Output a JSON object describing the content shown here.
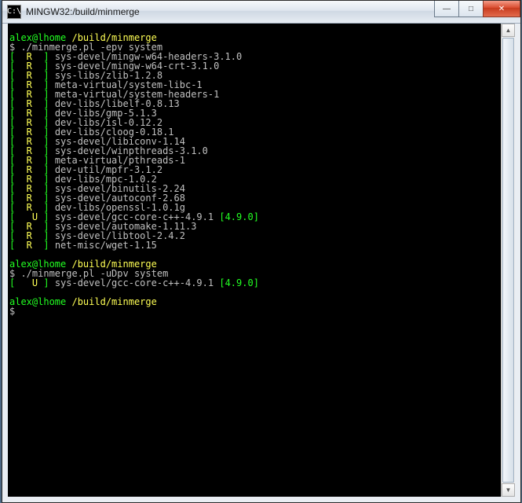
{
  "window": {
    "title": "MINGW32:/build/minmerge"
  },
  "controls": {
    "minimize_glyph": "—",
    "maximize_glyph": "□",
    "close_glyph": "✕"
  },
  "prompt": {
    "user_host": "alex@lhome",
    "path": "/build/minmerge",
    "sign": "$"
  },
  "blocks": [
    {
      "command": "./minmerge.pl -epv system",
      "rows": [
        {
          "flags": "  R  ",
          "pkg": "sys-devel/mingw-w64-headers-3.1.0"
        },
        {
          "flags": "  R  ",
          "pkg": "sys-devel/mingw-w64-crt-3.1.0"
        },
        {
          "flags": "  R  ",
          "pkg": "sys-libs/zlib-1.2.8"
        },
        {
          "flags": "  R  ",
          "pkg": "meta-virtual/system-libc-1"
        },
        {
          "flags": "  R  ",
          "pkg": "meta-virtual/system-headers-1"
        },
        {
          "flags": "  R  ",
          "pkg": "dev-libs/libelf-0.8.13"
        },
        {
          "flags": "  R  ",
          "pkg": "dev-libs/gmp-5.1.3"
        },
        {
          "flags": "  R  ",
          "pkg": "dev-libs/isl-0.12.2"
        },
        {
          "flags": "  R  ",
          "pkg": "dev-libs/cloog-0.18.1"
        },
        {
          "flags": "  R  ",
          "pkg": "sys-devel/libiconv-1.14"
        },
        {
          "flags": "  R  ",
          "pkg": "sys-devel/winpthreads-3.1.0"
        },
        {
          "flags": "  R  ",
          "pkg": "meta-virtual/pthreads-1"
        },
        {
          "flags": "  R  ",
          "pkg": "dev-util/mpfr-3.1.2"
        },
        {
          "flags": "  R  ",
          "pkg": "dev-libs/mpc-1.0.2"
        },
        {
          "flags": "  R  ",
          "pkg": "sys-devel/binutils-2.24"
        },
        {
          "flags": "  R  ",
          "pkg": "sys-devel/autoconf-2.68"
        },
        {
          "flags": "  R  ",
          "pkg": "dev-libs/openssl-1.0.1g"
        },
        {
          "flags": "   U ",
          "pkg": "sys-devel/gcc-core-c++-4.9.1",
          "extra": "[4.9.0]"
        },
        {
          "flags": "  R  ",
          "pkg": "sys-devel/automake-1.11.3"
        },
        {
          "flags": "  R  ",
          "pkg": "sys-devel/libtool-2.4.2"
        },
        {
          "flags": "  R  ",
          "pkg": "net-misc/wget-1.15"
        }
      ]
    },
    {
      "command": "./minmerge.pl -uDpv system",
      "rows": [
        {
          "flags": "   U ",
          "pkg": "sys-devel/gcc-core-c++-4.9.1",
          "extra": "[4.9.0]"
        }
      ]
    }
  ]
}
